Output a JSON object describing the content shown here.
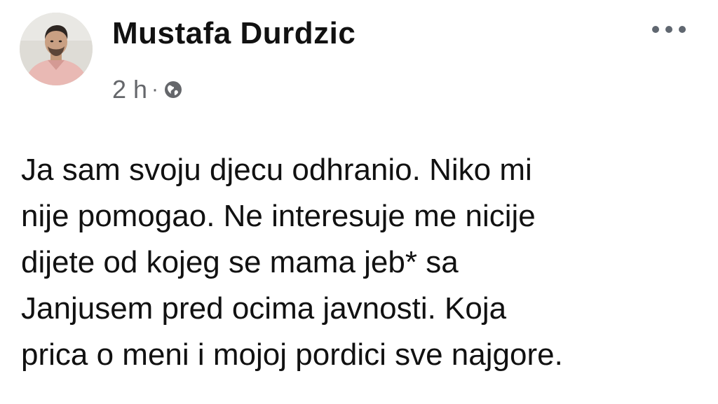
{
  "post": {
    "author": {
      "name": "Mustafa Durdzic",
      "avatar_icon": "profile-photo"
    },
    "meta": {
      "time": "2 h",
      "separator": "·",
      "privacy_icon": "globe-icon"
    },
    "menu_icon": "more-horizontal-icon",
    "text_lines": [
      "Ja sam svoju djecu odhranio. Niko mi",
      "nije pomogao. Ne interesuje me nicije",
      "dijete od kojeg se mama jeb* sa",
      "Janjusem pred ocima javnosti. Koja",
      "prica o meni i mojoj pordici sve najgore."
    ]
  },
  "colors": {
    "text": "#111111",
    "meta": "#65676b",
    "background": "#ffffff"
  }
}
